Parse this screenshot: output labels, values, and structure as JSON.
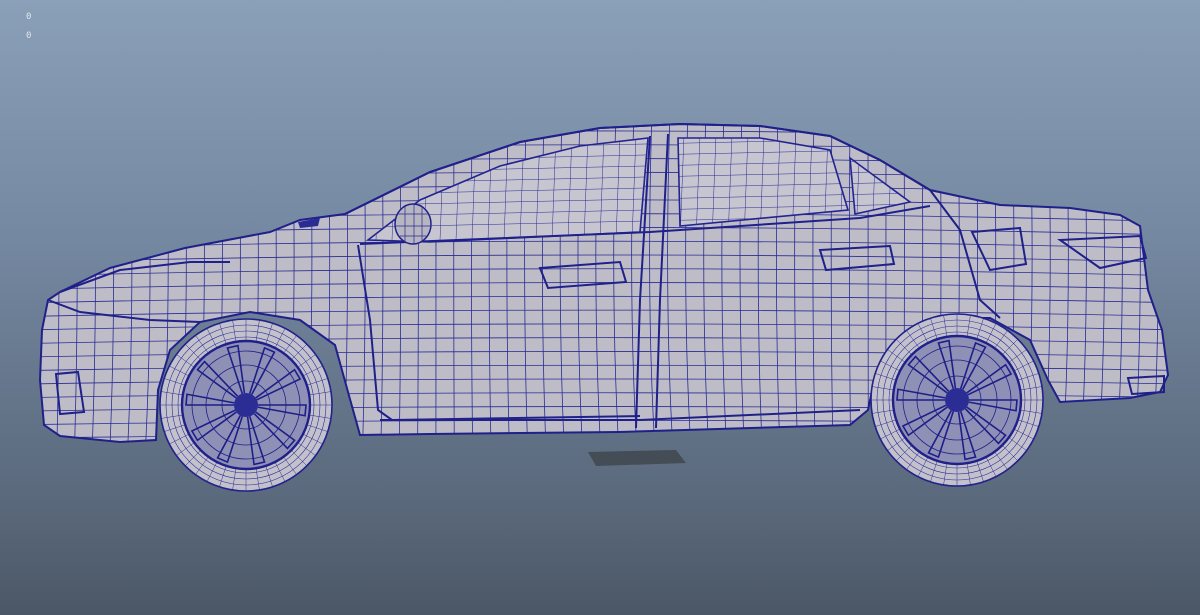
{
  "viewport": {
    "hud_lines": [
      "0",
      "0"
    ]
  },
  "colors": {
    "background_top": "#8aa0b8",
    "background_bottom": "#4b5766",
    "wire": "#22238f",
    "surface": "#bcbcc6"
  },
  "icons": {
    "model": "car-mesh-icon"
  }
}
